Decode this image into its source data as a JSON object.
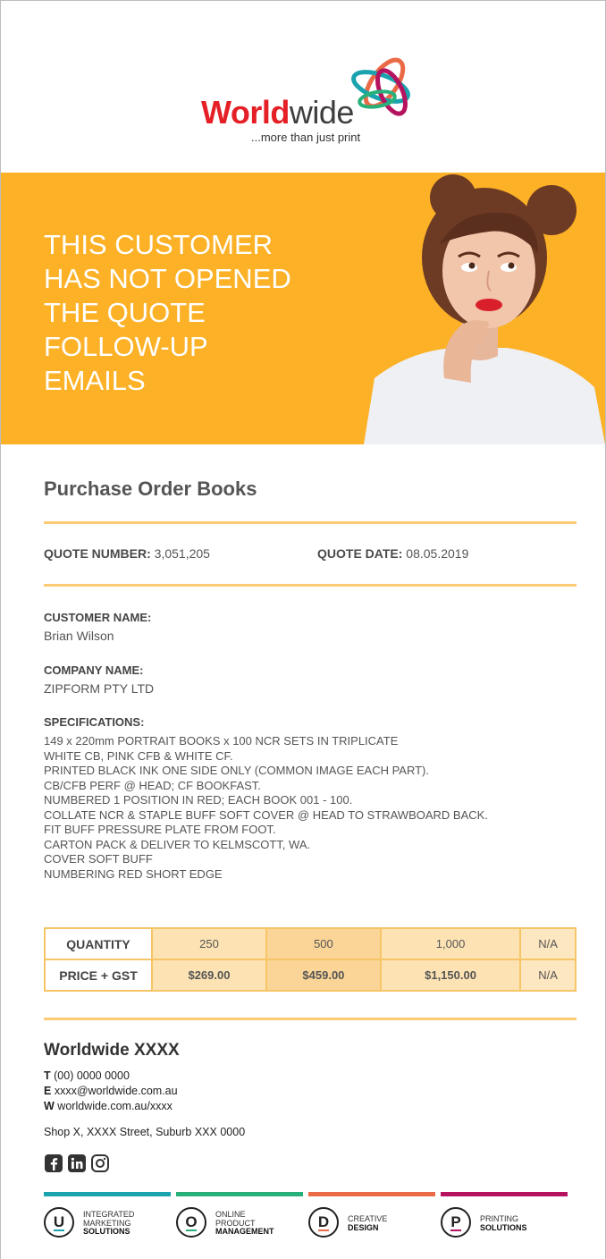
{
  "brand": {
    "name_bold": "World",
    "name_light": "wide",
    "tagline": "...more than just print",
    "colors": {
      "red": "#e41f26",
      "orange": "#fcb126",
      "teal": "#1aa3ae",
      "green": "#28b07b",
      "coral": "#ea6a47",
      "magenta": "#b5125f"
    }
  },
  "hero": {
    "lines": [
      "THIS CUSTOMER",
      "HAS NOT OPENED",
      "THE QUOTE",
      "FOLLOW-UP",
      "EMAILS"
    ]
  },
  "document": {
    "title": "Purchase Order Books",
    "quote_number_label": "QUOTE NUMBER:",
    "quote_number": "3,051,205",
    "quote_date_label": "QUOTE DATE:",
    "quote_date": "08.05.2019",
    "customer_label": "CUSTOMER NAME:",
    "customer_value": "Brian Wilson",
    "company_label": "COMPANY NAME:",
    "company_value": "ZIPFORM PTY LTD",
    "specs_label": "SPECIFICATIONS:",
    "specs": [
      "149 x 220mm PORTRAIT BOOKS x 100 NCR SETS IN TRIPLICATE",
      "WHITE CB, PINK CFB & WHITE CF.",
      "PRINTED BLACK INK ONE SIDE ONLY (COMMON IMAGE EACH PART).",
      "CB/CFB PERF @ HEAD; CF BOOKFAST.",
      "NUMBERED 1 POSITION IN RED; EACH BOOK 001 - 100.",
      "COLLATE NCR & STAPLE BUFF SOFT COVER @ HEAD TO STRAWBOARD BACK.",
      "FIT BUFF PRESSURE PLATE FROM FOOT.",
      "CARTON PACK & DELIVER TO KELMSCOTT, WA.",
      "COVER SOFT BUFF",
      "NUMBERING RED SHORT EDGE"
    ]
  },
  "price_table": {
    "quantity_label": "QUANTITY",
    "price_label": "PRICE + GST",
    "quantities": [
      "250",
      "500",
      "1,000",
      "N/A"
    ],
    "prices": [
      "$269.00",
      "$459.00",
      "$1,150.00",
      "N/A"
    ]
  },
  "footer": {
    "company": "Worldwide XXXX",
    "phone_label": "T",
    "phone": "(00) 0000 0000",
    "email_label": "E",
    "email": "xxxx@worldwide.com.au",
    "web_label": "W",
    "web": "worldwide.com.au/xxxx",
    "address": "Shop X, XXXX Street, Suburb XXX 0000",
    "socials": [
      "facebook-icon",
      "linkedin-icon",
      "instagram-icon"
    ],
    "units": [
      {
        "letter": "U",
        "line1": "INTEGRATED",
        "line2": "MARKETING",
        "line3": "SOLUTIONS"
      },
      {
        "letter": "O",
        "line1": "ONLINE",
        "line2": "PRODUCT",
        "line3": "MANAGEMENT"
      },
      {
        "letter": "D",
        "line1": "CREATIVE",
        "line2": "",
        "line3": "DESIGN"
      },
      {
        "letter": "P",
        "line1": "PRINTING",
        "line2": "",
        "line3": "SOLUTIONS"
      }
    ]
  }
}
